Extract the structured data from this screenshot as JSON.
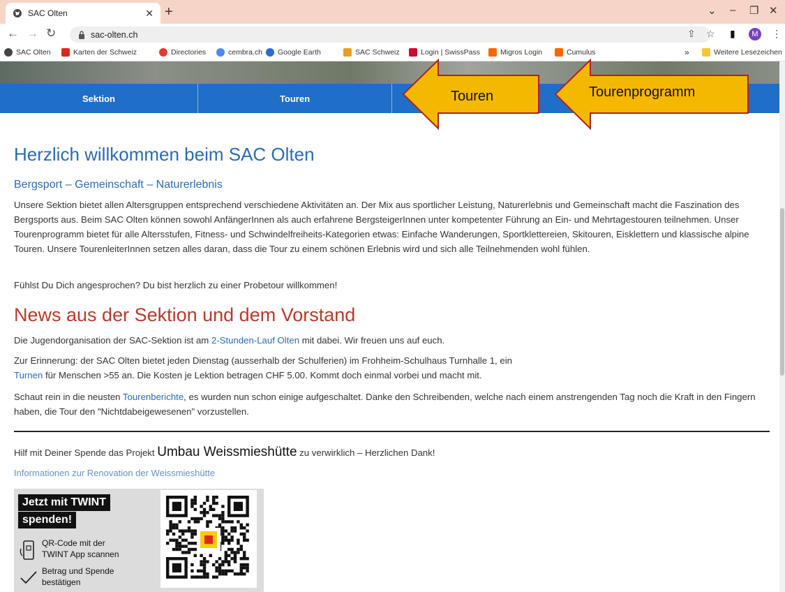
{
  "browser": {
    "tab_title": "SAC Olten",
    "url": "sac-olten.ch",
    "profile_initial": "M",
    "bookmarks": [
      "SAC Olten",
      "Karten der Schweiz",
      "Directories",
      "cembra.ch",
      "Google Earth",
      "SAC Schweiz",
      "Login | SwissPass",
      "Migros Login",
      "Cumulus"
    ],
    "bookmarks_more": "»",
    "other_bookmarks": "Weitere Lesezeichen"
  },
  "nav": {
    "items": [
      "Sektion",
      "Touren"
    ],
    "bg_color": "#1f6ec7"
  },
  "callouts": {
    "touren": "Touren",
    "tourenprogramm": "Tourenprogramm",
    "arrow_color": "#f5b800"
  },
  "welcome": {
    "title": "Herzlich willkommen beim SAC Olten",
    "subtitle": "Bergsport – Gemeinschaft – Naturerlebnis",
    "para1": "Unsere Sektion bietet allen Altersgruppen entsprechend verschiedene Aktivitäten an. Der Mix aus sportlicher Leistung, Naturerlebnis und Gemeinschaft macht die Faszination des Bergsports aus. Beim SAC Olten können sowohl AnfängerInnen als auch erfahrene BergsteigerInnen unter kompetenter Führung an Ein- und Mehrtagestouren teilnehmen. Unser Tourenprogramm bietet für alle Altersstufen, Fitness- und Schwindelfreiheits-Kategorien etwas: Einfache Wanderungen, Sportklettereien, Skitouren, Eisklettern und klassische alpine Touren. Unsere TourenleiterInnen setzen alles daran, dass die Tour zu einem schönen Erlebnis wird und sich alle Teilnehmenden wohl fühlen.",
    "para2": "Fühlst Du Dich angesprochen? Du bist herzlich zu einer Probetour willkommen!"
  },
  "news": {
    "title": "News aus der Sektion und dem Vorstand",
    "p1_before": "Die Jugendorganisation der SAC-Sektion ist am ",
    "p1_link": "2-Stunden-Lauf Olten",
    "p1_after": " mit dabei. Wir freuen uns auf euch.",
    "p2_line1": "Zur Erinnerung: der SAC Olten bietet jeden Dienstag (ausserhalb der Schulferien) im Frohheim-Schulhaus Turnhalle 1, ein",
    "p2_link": "Turnen",
    "p2_after": " für Menschen >55 an. Die Kosten je Lektion betragen CHF 5.00. Kommt doch einmal vorbei und macht mit.",
    "p3_before": "Schaut rein in die neusten ",
    "p3_link": "Tourenberichte",
    "p3_after": ", es wurden nun schon einige aufgeschaltet. Danke den Schreibenden, welche nach einem anstrengenden Tag noch die Kraft in den Fingern haben, die Tour den \"Nichtdabeigewesenen\" vorzustellen."
  },
  "donation": {
    "before": "Hilf mit Deiner Spende das Projekt ",
    "project": "Umbau Weissmieshütte",
    "after": " zu verwirklich – Herzlichen Dank!",
    "info_link": "Informationen zur Renovation der Weissmieshütte"
  },
  "twint": {
    "head1": "Jetzt mit TWINT",
    "head2": "spenden!",
    "step1_l1": "QR-Code mit der",
    "step1_l2": "TWINT App scannen",
    "step2_l1": "Betrag und Spende",
    "step2_l2": "bestätigen"
  }
}
